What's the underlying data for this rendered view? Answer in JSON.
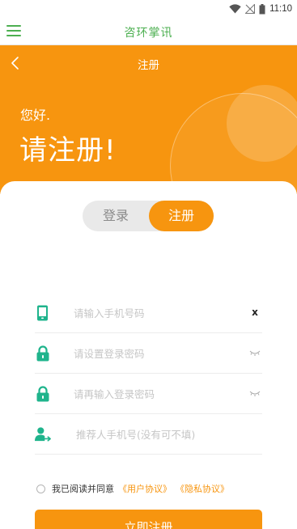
{
  "status_bar": {
    "time": "11:10",
    "icons": [
      "wifi-icon",
      "signal-off-icon",
      "battery-icon"
    ]
  },
  "app_header": {
    "title": "咨环掌讯",
    "menu_icon": "hamburger-menu-icon"
  },
  "nav": {
    "title": "注册",
    "back_icon": "chevron-left-icon"
  },
  "hero": {
    "greeting": "您好.",
    "title": "请注册!"
  },
  "toggle": {
    "login_label": "登录",
    "register_label": "注册",
    "active": "register"
  },
  "form": {
    "phone": {
      "placeholder": "请输入手机号码",
      "value": "",
      "icon": "phone-icon",
      "action": "x"
    },
    "password": {
      "placeholder": "请设置登录密码",
      "value": "",
      "icon": "lock-icon",
      "action_icon": "eye-closed-icon"
    },
    "confirm_password": {
      "placeholder": "请再输入登录密码",
      "value": "",
      "icon": "lock-icon",
      "action_icon": "eye-closed-icon"
    },
    "referrer": {
      "placeholder": "推荐人手机号(没有可不填)",
      "value": "",
      "icon": "user-transfer-icon"
    }
  },
  "agreement": {
    "text": "我已阅读并同意",
    "user_agreement": "《用户协议》",
    "privacy_agreement": "《隐私协议》",
    "checked": false
  },
  "submit_label": "立即注册",
  "colors": {
    "primary": "#f7950f",
    "accent_green": "#4caf50",
    "icon_teal": "#1fb48c"
  }
}
